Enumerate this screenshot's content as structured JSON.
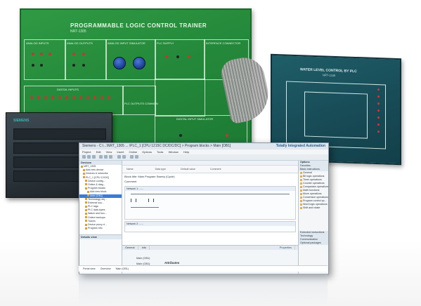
{
  "board": {
    "title": "PROGRAMMABLE LOGIC CONTROL TRAINER",
    "model": "NRT-1305",
    "panels": {
      "analog_inputs": "ANALOG INPUTS",
      "analog_outputs": "ANALOG OUTPUTS",
      "analog_input_simulator": "ANALOG INPUT SIMULATOR",
      "plc_supply": "PLC SUPPLY",
      "interface_connector": "INTERFACE CONNECTOR",
      "digital_inputs": "DIGITAL INPUTS",
      "plc_outputs_common": "PLC OUTPUTS COMMON",
      "digital_input_simulator": "DIGITAL INPUT SIMULATOR"
    }
  },
  "board2": {
    "title": "WATER LEVEL CONTROL BY PLC",
    "model": "NRT-1345"
  },
  "plc": {
    "brand": "SIEMENS"
  },
  "tia": {
    "title": "Siemens - C:\\...\\NRT_1305 ... \\PLC_1 [CPU 1215C DC/DC/DC] > Program blocks > Main [OB1]",
    "brand": "Totally Integrated Automation",
    "brand_sub": "PORTAL",
    "menu": [
      "Project",
      "Edit",
      "View",
      "Insert",
      "Online",
      "Options",
      "Tools",
      "Window",
      "Help"
    ],
    "tree": {
      "header": "Devices",
      "items": [
        "NRT_1305",
        "Add new device",
        "Devices & networks",
        "PLC_1 [CPU 1215C]",
        "Device config...",
        "Online & diag...",
        "Program blocks",
        "Add new block",
        "Main [OB1]",
        "Technology obj...",
        "External sou...",
        "PLC tags",
        "PLC data types",
        "Watch and forc...",
        "Online backups",
        "Traces",
        "Device proxy d...",
        "Program info",
        "Local modules"
      ]
    },
    "details": "Details view",
    "editor": {
      "iface_cols": [
        "Name",
        "Data type",
        "Default value",
        "Comment"
      ],
      "block_title": "Block title:   Main Program Sweep (Cycle)",
      "comment": "Comment",
      "network1": "Network 1:   ......",
      "network2": "Network 2:   ......"
    },
    "right": {
      "header": "Options",
      "sections": [
        "Favorites",
        "Basic instructions"
      ],
      "items": [
        "General",
        "Bit logic operations",
        "Timer operations",
        "Counter operations",
        "Comparator operations",
        "Math functions",
        "Move operations",
        "Conversion operations",
        "Program control op...",
        "Word logic operations",
        "Shift and rotate"
      ],
      "bottom": [
        "Extended instructions",
        "Technology",
        "Communication",
        "Optional packages"
      ]
    },
    "inspector": {
      "tabs": [
        "General",
        "Info"
      ],
      "props": "Properties",
      "attributes": "Attributes",
      "rows": [
        "Main (OB1)",
        "Main (OB1)"
      ]
    },
    "taskbar": [
      "Portal view",
      "Overview",
      "Main (OB1)"
    ]
  }
}
